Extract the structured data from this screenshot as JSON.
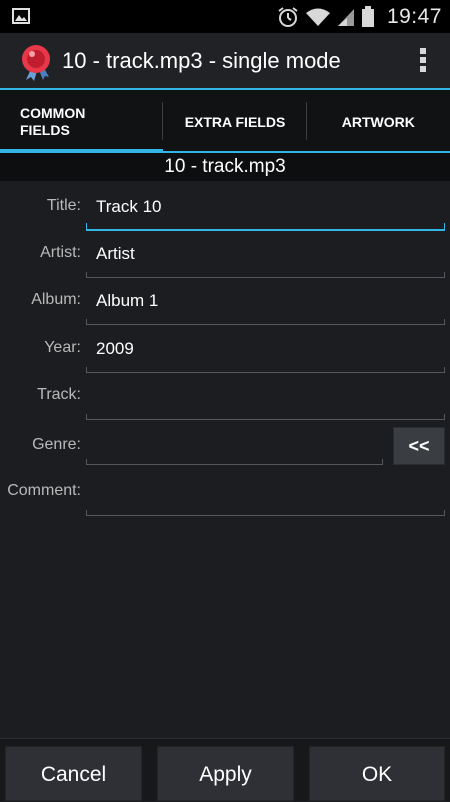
{
  "status_bar": {
    "time": "19:47",
    "icons": [
      "image-notification-icon",
      "alarm-icon",
      "wifi-icon",
      "cell-signal-icon",
      "battery-icon"
    ]
  },
  "action_bar": {
    "title": "10 - track.mp3 - single mode"
  },
  "tabs": [
    {
      "label_line1": "COMMON",
      "label_line2": "FIELDS",
      "selected": true
    },
    {
      "label": "EXTRA FIELDS",
      "selected": false
    },
    {
      "label": "ARTWORK",
      "selected": false
    }
  ],
  "file_header": "10 - track.mp3",
  "form": {
    "title": {
      "label": "Title:",
      "value": "Track 10"
    },
    "artist": {
      "label": "Artist:",
      "value": "Artist"
    },
    "album": {
      "label": "Album:",
      "value": "Album 1"
    },
    "year": {
      "label": "Year:",
      "value": "2009"
    },
    "track": {
      "label": "Track:",
      "value": ""
    },
    "genre": {
      "label": "Genre:",
      "value": "",
      "button": "<<"
    },
    "comment": {
      "label": "Comment:",
      "value": ""
    }
  },
  "buttons": {
    "cancel": "Cancel",
    "apply": "Apply",
    "ok": "OK"
  },
  "colors": {
    "accent": "#33b5e5",
    "background": "#1b1d20"
  }
}
